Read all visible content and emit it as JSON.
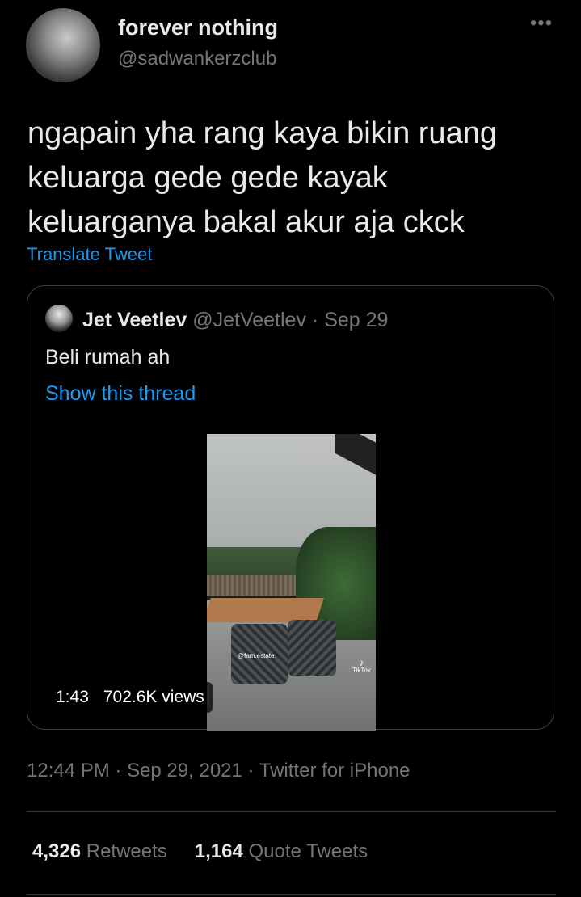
{
  "author": {
    "name": "forever nothing",
    "handle": "@sadwankerzclub"
  },
  "more_icon": "more-dots-icon",
  "tweet": {
    "text": "ngapain yha rang kaya bikin ruang keluarga gede gede kayak keluarganya bakal akur aja ckck",
    "translate_label": "Translate Tweet"
  },
  "quoted": {
    "name": "Jet Veetlev",
    "handle": "@JetVeetlev",
    "separator": " · ",
    "date": "Sep 29",
    "text": "Beli rumah ah",
    "thread_link": "Show this thread",
    "video": {
      "duration": "1:43",
      "views": "702.6K views",
      "watermark_handle": "@fam.estate",
      "watermark_app": "TikTok"
    }
  },
  "meta": {
    "time": "12:44 PM",
    "date": "Sep 29, 2021",
    "source": "Twitter for iPhone",
    "separator": " · "
  },
  "stats": {
    "retweets_count": "4,326",
    "retweets_label": "Retweets",
    "quotes_count": "1,164",
    "quotes_label": "Quote Tweets"
  },
  "colors": {
    "background": "#000000",
    "link": "#1d9bf0",
    "secondary_text": "#71767b"
  }
}
